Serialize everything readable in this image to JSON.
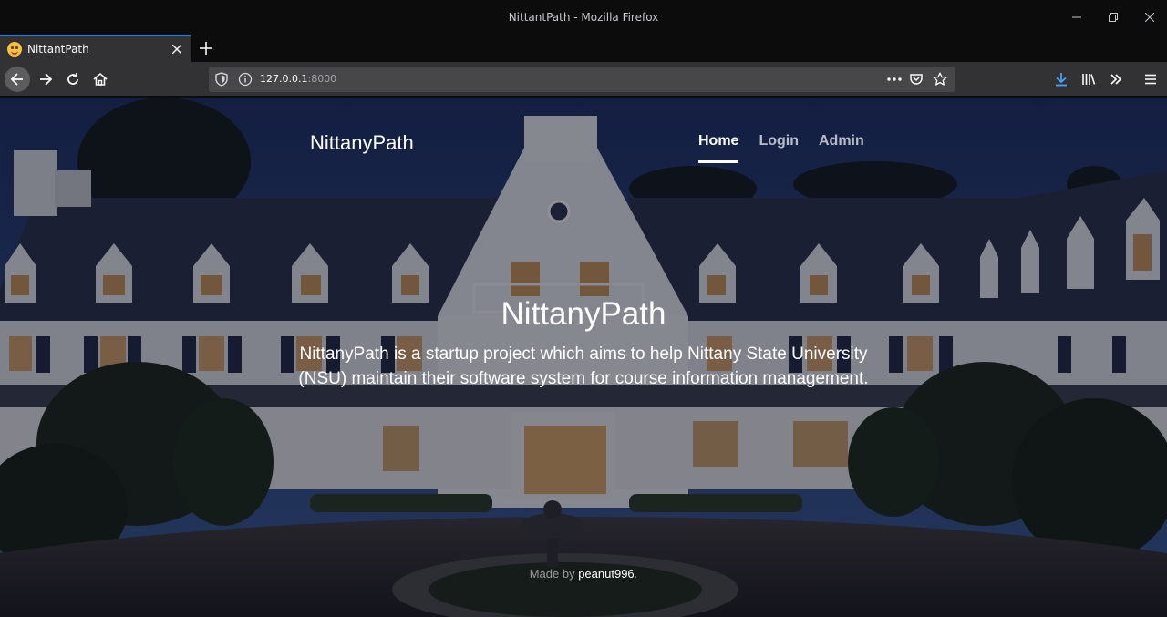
{
  "window": {
    "title": "NittantPath - Mozilla Firefox"
  },
  "tabs": [
    {
      "label": "NittantPath",
      "active": true
    }
  ],
  "urlbar": {
    "host": "127.0.0.1",
    "port": ":8000"
  },
  "site": {
    "brand": "NittanyPath",
    "nav": [
      {
        "label": "Home",
        "active": true
      },
      {
        "label": "Login",
        "active": false
      },
      {
        "label": "Admin",
        "active": false
      }
    ],
    "hero": {
      "heading": "NittanyPath",
      "lead": "NittanyPath is a startup project which aims to help Nittany State University (NSU) maintain their software system for course information management."
    },
    "footer": {
      "prefix": "Made by ",
      "author": "peanut996",
      "suffix": "."
    }
  },
  "colors": {
    "accent": "#0a84ff",
    "toolbar": "#323234",
    "titlebar": "#0c0c0d"
  }
}
